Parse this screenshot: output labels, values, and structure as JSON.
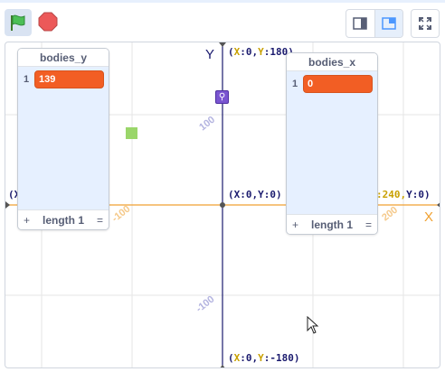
{
  "toolbar": {
    "green_flag_icon": "green-flag-icon",
    "stop_icon": "stop-icon",
    "small_stage_icon": "small-stage-icon",
    "normal_stage_icon": "normal-stage-icon",
    "fullscreen_icon": "fullscreen-icon"
  },
  "stage": {
    "axis_x_letter": "X",
    "axis_y_letter": "Y",
    "coords": {
      "top": {
        "open": "(",
        "xk": "X",
        "xv": ":0,",
        "yk": "Y",
        "yv": ":180)"
      },
      "center": "(X:0,Y:0)",
      "right": {
        "part1": ":240,",
        "part2": "Y:0)"
      },
      "left": "(X",
      "bottom": {
        "open": "(",
        "xk": "X",
        "xv": ":0,",
        "yk": "Y",
        "yv": ":-180)"
      }
    },
    "ticks": {
      "y_pos": "100",
      "y_neg": "-100",
      "x_pos": "200",
      "x_neg": "-100"
    }
  },
  "lists": {
    "bodies_y": {
      "title": "bodies_y",
      "index": "1",
      "value": "139",
      "add": "+",
      "length": "length 1",
      "resize": "="
    },
    "bodies_x": {
      "title": "bodies_x",
      "index": "1",
      "value": "0",
      "add": "+",
      "length": "length 1",
      "resize": "="
    }
  },
  "colors": {
    "x_axis": "#f0a030",
    "y_axis": "#1a1a6e",
    "list_item": "#f25e24",
    "grid": "#e3e3e3"
  }
}
